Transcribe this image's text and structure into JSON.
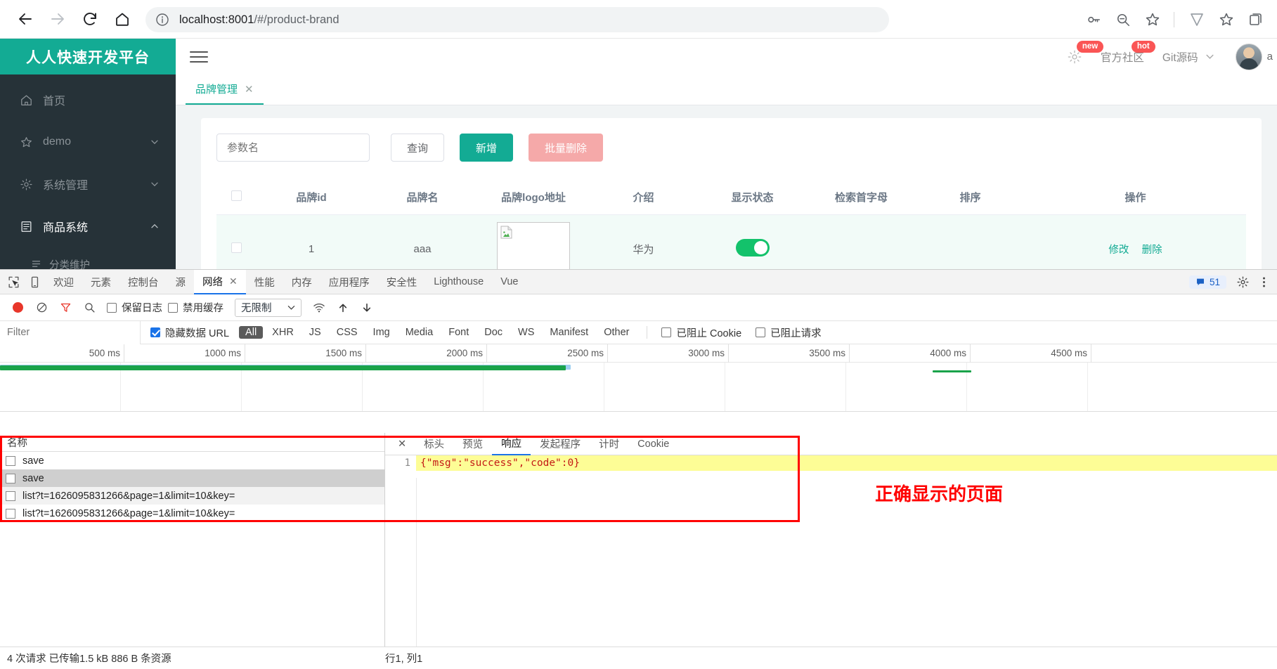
{
  "browser": {
    "url_host": "localhost:8001",
    "url_path": "/#/product-brand",
    "back_icon": "back-arrow-icon",
    "forward_icon": "forward-arrow-icon",
    "reload_icon": "reload-icon",
    "home_icon": "home-icon",
    "info_icon": "info-circle-icon",
    "right_icons": [
      "key-icon",
      "zoom-out-icon",
      "favorite-add-icon",
      "brave-icon",
      "favorites-icon",
      "collections-icon"
    ]
  },
  "app": {
    "logo_text": "人人快速开发平台",
    "brand_color": "#13ab94",
    "sidebar": [
      {
        "label": "首页",
        "icon": "home-icon",
        "chevron": "",
        "active": false
      },
      {
        "label": "demo",
        "icon": "star-icon",
        "chevron": "down",
        "active": false
      },
      {
        "label": "系统管理",
        "icon": "gear-icon",
        "chevron": "down",
        "active": false
      },
      {
        "label": "商品系统",
        "icon": "book-icon",
        "chevron": "up",
        "active": true
      }
    ],
    "submenu": [
      {
        "label": "分类维护",
        "icon": "list-icon"
      }
    ],
    "topbar": {
      "menu_toggle_icon": "hamburger-icon",
      "gear_icon": "gear-icon",
      "gear_badge": "new",
      "community_label": "官方社区",
      "community_badge": "hot",
      "git_label": "Git源码",
      "git_chevron_icon": "chevron-down-icon",
      "avatar_icon": "user-avatar",
      "user_name": "a"
    },
    "tab": {
      "label": "品牌管理",
      "close_icon": "close-icon"
    },
    "toolbar": {
      "search_placeholder": "参数名",
      "search_value": "",
      "query_label": "查询",
      "add_label": "新增",
      "batch_delete_label": "批量删除"
    },
    "table": {
      "columns": [
        "",
        "品牌id",
        "品牌名",
        "品牌logo地址",
        "介绍",
        "显示状态",
        "检索首字母",
        "排序",
        "操作"
      ],
      "rows": [
        {
          "id": "1",
          "name": "aaa",
          "logo": "broken-image-icon",
          "intro": "华为",
          "show_status": true,
          "first_letter": "",
          "sort": "",
          "actions": [
            "修改",
            "删除"
          ]
        }
      ]
    }
  },
  "devtools": {
    "left_icons": [
      "inspect-element-icon",
      "device-toolbar-icon"
    ],
    "tabs": [
      {
        "label": "欢迎",
        "active": false,
        "closable": false
      },
      {
        "label": "元素",
        "active": false,
        "closable": false
      },
      {
        "label": "控制台",
        "active": false,
        "closable": false
      },
      {
        "label": "源",
        "active": false,
        "closable": false
      },
      {
        "label": "网络",
        "active": true,
        "closable": true,
        "close_icon": "close-icon"
      },
      {
        "label": "性能",
        "active": false,
        "closable": false
      },
      {
        "label": "内存",
        "active": false,
        "closable": false
      },
      {
        "label": "应用程序",
        "active": false,
        "closable": false
      },
      {
        "label": "安全性",
        "active": false,
        "closable": false
      },
      {
        "label": "Lighthouse",
        "active": false,
        "closable": false
      },
      {
        "label": "Vue",
        "active": false,
        "closable": false
      }
    ],
    "issues_count": "51",
    "issues_icon": "message-icon",
    "settings_icon": "gear-icon",
    "more_icon": "more-options-icon",
    "controls": {
      "record_icon": "record-stop-icon",
      "clear_icon": "clear-icon",
      "filter_icon": "filter-funnel-icon",
      "search_icon": "search-icon",
      "preserve_log_label": "保留日志",
      "preserve_log_checked": false,
      "disable_cache_label": "禁用缓存",
      "disable_cache_checked": false,
      "throttle_value": "无限制",
      "throttle_chevron_icon": "chevron-down-icon",
      "wifi_icon": "network-conditions-icon",
      "import_icon": "upload-har-icon",
      "export_icon": "download-har-icon"
    },
    "filterbar": {
      "filter_placeholder": "Filter",
      "filter_value": "",
      "hide_data_urls_label": "隐藏数据 URL",
      "hide_data_urls_checked": true,
      "types": [
        "All",
        "XHR",
        "JS",
        "CSS",
        "Img",
        "Media",
        "Font",
        "Doc",
        "WS",
        "Manifest",
        "Other"
      ],
      "active_type": "All",
      "blocked_cookies_label": "已阻止 Cookie",
      "blocked_cookies_checked": false,
      "blocked_requests_label": "已阻止请求",
      "blocked_requests_checked": false
    },
    "timeline": {
      "ticks": [
        "500 ms",
        "1000 ms",
        "1500 ms",
        "2000 ms",
        "2500 ms",
        "3000 ms",
        "3500 ms",
        "4000 ms",
        "4500 ms"
      ]
    },
    "requests": {
      "header": "名称",
      "items": [
        {
          "name": "save",
          "selected": false
        },
        {
          "name": "save",
          "selected": true
        },
        {
          "name": "list?t=1626095831266&page=1&limit=10&key=",
          "selected": false
        },
        {
          "name": "list?t=1626095831266&page=1&limit=10&key=",
          "selected": false
        }
      ]
    },
    "detail": {
      "close_icon": "close-icon",
      "tabs": [
        "标头",
        "预览",
        "响应",
        "发起程序",
        "计时",
        "Cookie"
      ],
      "active_tab": "响应",
      "line_number": "1",
      "response_body": "{\"msg\":\"success\",\"code\":0}"
    },
    "annotation": {
      "text": "正确显示的页面",
      "color": "#ff0000"
    },
    "status": {
      "summary": "4 次请求  已传输1.5 kB  886 B 条资源",
      "cursor": "行1, 列1"
    }
  }
}
